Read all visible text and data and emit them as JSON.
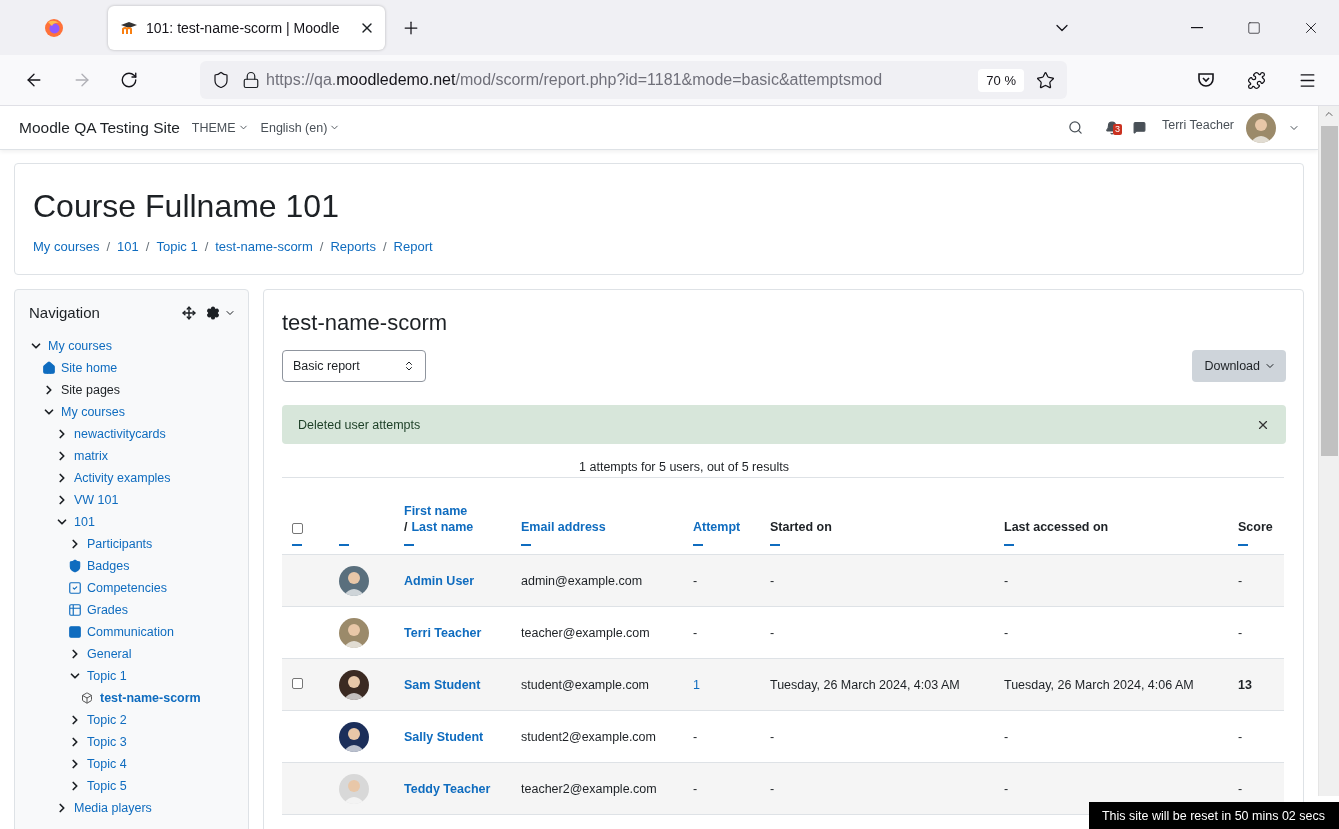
{
  "browser": {
    "tab_title": "101: test-name-scorm | Moodle",
    "url": {
      "prefix": "https://qa.",
      "host": "moodledemo.net",
      "path": "/mod/scorm/report.php?id=1181&mode=basic&attemptsmod"
    },
    "zoom": "70 %",
    "forward_disabled": true
  },
  "navbar": {
    "site_name": "Moodle QA Testing Site",
    "menus": [
      "THEME",
      "English (en)"
    ],
    "notifications": "3",
    "user": "Terri Teacher"
  },
  "header": {
    "title": "Course Fullname 101",
    "breadcrumbs": [
      {
        "label": "My courses"
      },
      {
        "separator": "/",
        "label": "101"
      },
      {
        "separator": "/",
        "label": "Topic 1"
      },
      {
        "separator": "/",
        "label": "test-name-scorm"
      },
      {
        "separator": "/",
        "label": "Reports"
      },
      {
        "separator": "/",
        "label": "Report"
      }
    ]
  },
  "navigation": {
    "title": "Navigation",
    "tree": [
      {
        "label": "My courses",
        "kind": "branch",
        "expanded": true,
        "children": [
          {
            "label": "Site home",
            "kind": "home"
          },
          {
            "label": "Site pages",
            "kind": "category",
            "expanded": false
          },
          {
            "label": "My courses",
            "kind": "branch",
            "expanded": true,
            "children": [
              {
                "label": "newactivitycards",
                "kind": "branch",
                "expanded": false
              },
              {
                "label": "matrix",
                "kind": "branch",
                "expanded": false
              },
              {
                "label": "Activity examples",
                "kind": "branch",
                "expanded": false
              },
              {
                "label": "VW 101",
                "kind": "branch",
                "expanded": false
              },
              {
                "label": "101",
                "kind": "branch",
                "expanded": true,
                "children": [
                  {
                    "label": "Participants",
                    "kind": "branch",
                    "expanded": false
                  },
                  {
                    "label": "Badges",
                    "kind": "badge"
                  },
                  {
                    "label": "Competencies",
                    "kind": "competency"
                  },
                  {
                    "label": "Grades",
                    "kind": "grades"
                  },
                  {
                    "label": "Communication",
                    "kind": "communication"
                  },
                  {
                    "label": "General",
                    "kind": "branch",
                    "expanded": false
                  },
                  {
                    "label": "Topic 1",
                    "kind": "branch",
                    "expanded": true,
                    "children": [
                      {
                        "label": "test-name-scorm",
                        "kind": "activity"
                      }
                    ]
                  },
                  {
                    "label": "Topic 2",
                    "kind": "branch",
                    "expanded": false
                  },
                  {
                    "label": "Topic 3",
                    "kind": "branch",
                    "expanded": false
                  },
                  {
                    "label": "Topic 4",
                    "kind": "branch",
                    "expanded": false
                  },
                  {
                    "label": "Topic 5",
                    "kind": "branch",
                    "expanded": false
                  }
                ]
              },
              {
                "label": "Media players",
                "kind": "branch",
                "expanded": false
              }
            ]
          }
        ]
      }
    ]
  },
  "main": {
    "title": "test-name-scorm",
    "report_select": "Basic report",
    "download": "Download",
    "alert": "Deleted user attempts",
    "summary": "1 attempts for 5 users, out of 5 results",
    "columns": [
      {
        "kind": "checkbox",
        "checked": false
      },
      {
        "kind": "picture"
      },
      {
        "kind": "name",
        "label": "First name",
        "separator": "/",
        "label2": "Last name"
      },
      {
        "kind": "link",
        "label": "Email address"
      },
      {
        "kind": "link",
        "label": "Attempt"
      },
      {
        "kind": "text",
        "label": "Started on"
      },
      {
        "kind": "text",
        "label": "Last accessed on"
      },
      {
        "kind": "text",
        "label": "Score"
      }
    ],
    "rows": [
      {
        "name": "Admin User",
        "email": "admin@example.com",
        "attempt": {
          "text": "-",
          "link": false
        },
        "started": "-",
        "accessed": "-",
        "score": {
          "text": "-",
          "bold": false
        }
      },
      {
        "name": "Terri Teacher",
        "email": "teacher@example.com",
        "attempt": {
          "text": "-",
          "link": false
        },
        "started": "-",
        "accessed": "-",
        "score": {
          "text": "-",
          "bold": false
        }
      },
      {
        "name": "Sam Student",
        "email": "student@example.com",
        "checkbox": {
          "checked": false
        },
        "attempt": {
          "text": "1",
          "link": true
        },
        "started": "Tuesday, 26 March 2024, 4:03 AM",
        "accessed": "Tuesday, 26 March 2024, 4:06 AM",
        "score": {
          "text": "13",
          "bold": true
        }
      },
      {
        "name": "Sally Student",
        "email": "student2@example.com",
        "attempt": {
          "text": "-",
          "link": false
        },
        "started": "-",
        "accessed": "-",
        "score": {
          "text": "-",
          "bold": false
        }
      },
      {
        "name": "Teddy Teacher",
        "email": "teacher2@example.com",
        "attempt": {
          "text": "-",
          "link": false
        },
        "started": "-",
        "accessed": "-",
        "score": {
          "text": "-",
          "bold": false
        }
      }
    ]
  },
  "reset_notice": "This site will be reset in 50 mins 02 secs"
}
